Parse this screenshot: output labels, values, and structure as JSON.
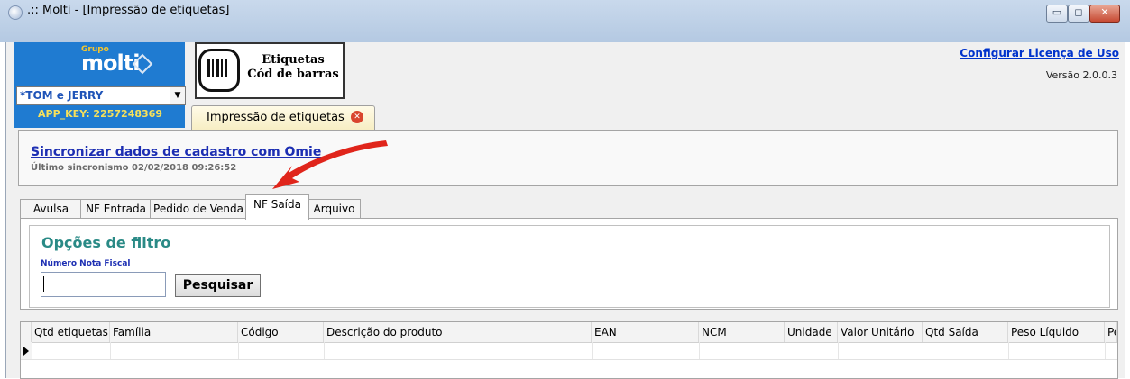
{
  "window": {
    "title": ".:: Molti - [Impressão de etiquetas]",
    "buttons": {
      "minimize": "▭",
      "maximize": "◻",
      "close": "✕"
    }
  },
  "logo": {
    "grupo": "Grupo",
    "brand": "molti"
  },
  "company_select": {
    "value": "*TOM e JERRY"
  },
  "app_key": "APP_KEY: 2257248369",
  "module": {
    "title_line1": "Etiquetas",
    "title_line2": "Cód de barras"
  },
  "main_tab": {
    "label": "Impressão de etiquetas"
  },
  "header_right": {
    "config_link": "Configurar Licença de Uso",
    "version": "Versão 2.0.0.3"
  },
  "sync": {
    "link": "Sincronizar dados de cadastro com Omie",
    "last": "Último sincronismo 02/02/2018 09:26:52"
  },
  "subtabs": [
    {
      "label": "Avulsa"
    },
    {
      "label": "NF Entrada"
    },
    {
      "label": "Pedido de Venda"
    },
    {
      "label": "NF Saída",
      "active": true
    },
    {
      "label": "Arquivo"
    }
  ],
  "filter": {
    "title": "Opções de filtro",
    "field_label": "Número Nota Fiscal",
    "field_value": "",
    "search_button": "Pesquisar"
  },
  "grid": {
    "columns": [
      "Qtd etiquetas",
      "Família",
      "Código",
      "Descrição do produto",
      "EAN",
      "NCM",
      "Unidade",
      "Valor Unitário",
      "Qtd Saída",
      "Peso Líquido",
      "Pes"
    ]
  },
  "colors": {
    "accent": "#1f7bd1",
    "link": "#1d2fb3",
    "filter_title": "#2a8a86",
    "annotation_arrow": "#e0251b"
  }
}
